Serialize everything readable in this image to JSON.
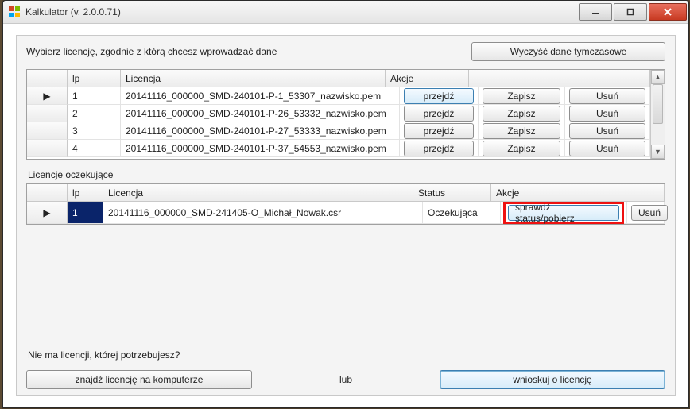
{
  "window": {
    "title": "Kalkulator (v. 2.0.0.71)"
  },
  "top": {
    "instruction": "Wybierz licencję, zgodnie z którą chcesz wprowadzać dane",
    "clear_button": "Wyczyść dane tymczasowe"
  },
  "grid1": {
    "headers": {
      "lp": "lp",
      "licencja": "Licencja",
      "akcje": "Akcje"
    },
    "action_labels": {
      "przejdz": "przejdź",
      "zapisz": "Zapisz",
      "usun": "Usuń"
    },
    "rows": [
      {
        "lp": "1",
        "licencja": "20141116_000000_SMD-240101-P-1_53307_nazwisko.pem"
      },
      {
        "lp": "2",
        "licencja": "20141116_000000_SMD-240101-P-26_53332_nazwisko.pem"
      },
      {
        "lp": "3",
        "licencja": "20141116_000000_SMD-240101-P-27_53333_nazwisko.pem"
      },
      {
        "lp": "4",
        "licencja": "20141116_000000_SMD-240101-P-37_54553_nazwisko.pem"
      }
    ]
  },
  "pending": {
    "title": "Licencje oczekujące",
    "headers": {
      "lp": "lp",
      "licencja": "Licencja",
      "status": "Status",
      "akcje": "Akcje"
    },
    "action_labels": {
      "check": "sprawdź status/pobierz",
      "usun": "Usuń"
    },
    "rows": [
      {
        "lp": "1",
        "licencja": "20141116_000000_SMD-241405-O_Michał_Nowak.csr",
        "status": "Oczekująca"
      }
    ]
  },
  "bottom": {
    "prompt": "Nie ma licencji, której potrzebujesz?",
    "find_button": "znajdź licencję na komputerze",
    "or": "lub",
    "request_button": "wnioskuj o licencję"
  }
}
